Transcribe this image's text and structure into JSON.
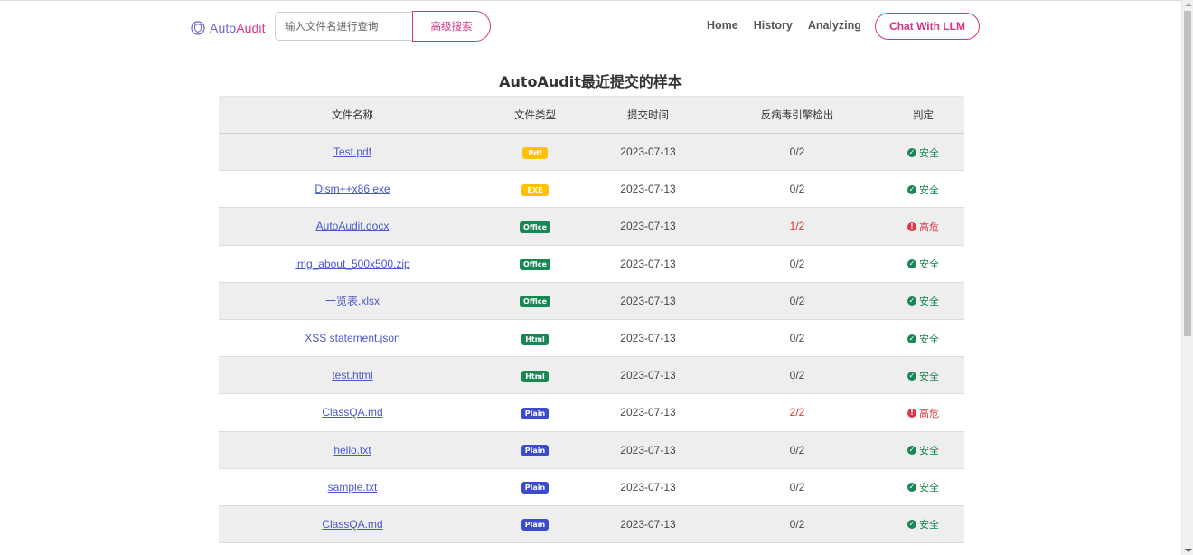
{
  "brand": {
    "prefix": "Auto",
    "suffix": "Audit"
  },
  "search": {
    "placeholder": "输入文件名进行查询",
    "button_label": "高级搜索"
  },
  "nav": {
    "home": "Home",
    "history": "History",
    "analyzing": "Analyzing",
    "chat_button": "Chat With LLM"
  },
  "page_title": "AutoAudit最近提交的样本",
  "table": {
    "headers": [
      "文件名称",
      "文件类型",
      "提交时间",
      "反病毒引擎检出",
      "判定"
    ],
    "rows": [
      {
        "name": "Test.pdf",
        "type": "Pdf",
        "type_class": "pdf",
        "date": "2023-07-13",
        "detect": "0/2",
        "verdict": "安全",
        "level": "safe"
      },
      {
        "name": "Dism++x86.exe",
        "type": "EXE",
        "type_class": "exe",
        "date": "2023-07-13",
        "detect": "0/2",
        "verdict": "安全",
        "level": "safe"
      },
      {
        "name": "AutoAudit.docx",
        "type": "Office",
        "type_class": "office",
        "date": "2023-07-13",
        "detect": "1/2",
        "verdict": "高危",
        "level": "danger"
      },
      {
        "name": "img_about_500x500.zip",
        "type": "Office",
        "type_class": "office",
        "date": "2023-07-13",
        "detect": "0/2",
        "verdict": "安全",
        "level": "safe"
      },
      {
        "name": "一览表.xlsx",
        "type": "Office",
        "type_class": "office",
        "date": "2023-07-13",
        "detect": "0/2",
        "verdict": "安全",
        "level": "safe"
      },
      {
        "name": "XSS statement.json",
        "type": "Html",
        "type_class": "html",
        "date": "2023-07-13",
        "detect": "0/2",
        "verdict": "安全",
        "level": "safe"
      },
      {
        "name": "test.html",
        "type": "Html",
        "type_class": "html",
        "date": "2023-07-13",
        "detect": "0/2",
        "verdict": "安全",
        "level": "safe"
      },
      {
        "name": "ClassQA.md",
        "type": "Plain",
        "type_class": "plain",
        "date": "2023-07-13",
        "detect": "2/2",
        "verdict": "高危",
        "level": "danger"
      },
      {
        "name": "hello.txt",
        "type": "Plain",
        "type_class": "plain",
        "date": "2023-07-13",
        "detect": "0/2",
        "verdict": "安全",
        "level": "safe"
      },
      {
        "name": "sample.txt",
        "type": "Plain",
        "type_class": "plain",
        "date": "2023-07-13",
        "detect": "0/2",
        "verdict": "安全",
        "level": "safe"
      },
      {
        "name": "ClassQA.md",
        "type": "Plain",
        "type_class": "plain",
        "date": "2023-07-13",
        "detect": "0/2",
        "verdict": "安全",
        "level": "safe"
      }
    ]
  },
  "colors": {
    "brand_pink": "#d63384",
    "brand_purple": "#6f63c9",
    "safe": "#198754",
    "danger": "#dc3545",
    "link": "#4a58c9"
  },
  "icons": {
    "brand": "shield-icon",
    "safe": "check-circle-icon",
    "danger": "exclamation-circle-icon"
  }
}
